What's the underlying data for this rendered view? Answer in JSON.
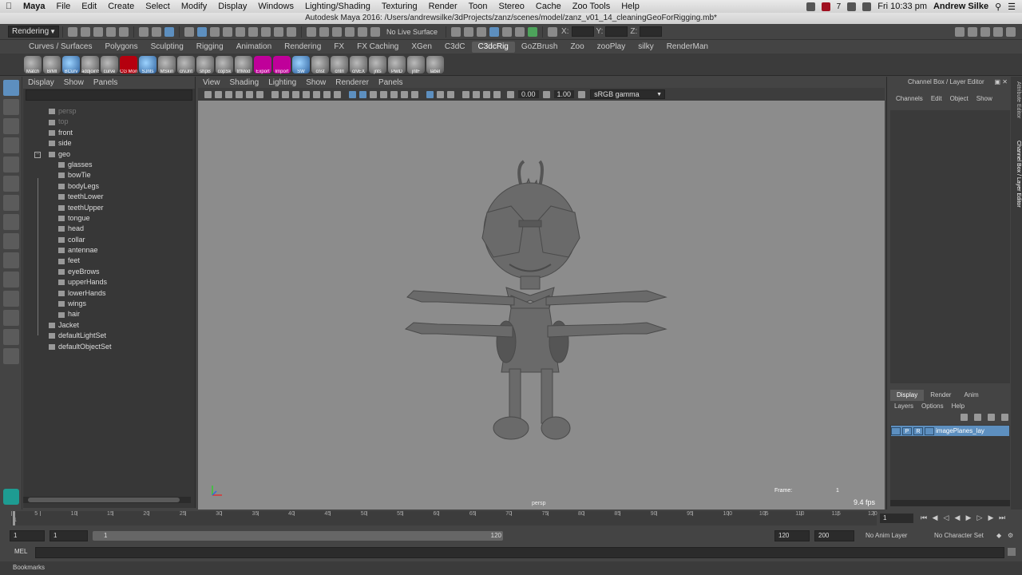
{
  "mac_menubar": {
    "app_name": "Maya",
    "items": [
      "File",
      "Edit",
      "Create",
      "Select",
      "Modify",
      "Display",
      "Windows",
      "Lighting/Shading",
      "Texturing",
      "Render",
      "Toon",
      "Stereo",
      "Cache",
      "Zoo Tools",
      "Help"
    ],
    "right": {
      "badge": "7",
      "clock": "Fri 10:33 pm",
      "user": "Andrew Silke"
    }
  },
  "window": {
    "title": "Autodesk Maya 2016: /Users/andrewsilke/3dProjects/zanz/scenes/model/zanz_v01_14_cleaningGeoForRigging.mb*"
  },
  "status_line": {
    "menu_set": "Rendering",
    "live_surface": "No Live Surface",
    "coord_x": "X:",
    "coord_y": "Y:",
    "coord_z": "Z:"
  },
  "shelf_tabs": [
    "Curves / Surfaces",
    "Polygons",
    "Sculpting",
    "Rigging",
    "Animation",
    "Rendering",
    "FX",
    "FX Caching",
    "XGen",
    "C3dC",
    "C3dcRig",
    "GoZBrush",
    "Zoo",
    "zooPlay",
    "silky",
    "RenderMan"
  ],
  "shelf_active_tab": "C3dcRig",
  "shelf_buttons": [
    {
      "label": "Match",
      "style": ""
    },
    {
      "label": "BrMl",
      "style": ""
    },
    {
      "label": "BCurv",
      "style": "blue"
    },
    {
      "label": "addjoints",
      "style": ""
    },
    {
      "label": "curve",
      "style": ""
    },
    {
      "label": "CG Mon",
      "style": "red"
    },
    {
      "label": "SJnts",
      "style": "blue"
    },
    {
      "label": "MSkin",
      "style": ""
    },
    {
      "label": "crvJnt",
      "style": ""
    },
    {
      "label": "shpB",
      "style": ""
    },
    {
      "label": "copSk",
      "style": ""
    },
    {
      "label": "trfMod",
      "style": ""
    },
    {
      "label": "Export",
      "style": "magenta"
    },
    {
      "label": "Import",
      "style": "magenta"
    },
    {
      "label": "SW",
      "style": "blue"
    },
    {
      "label": "cnst",
      "style": ""
    },
    {
      "label": "cntrl",
      "style": ""
    },
    {
      "label": "crvEX",
      "style": ""
    },
    {
      "label": "jnts",
      "style": ""
    },
    {
      "label": "PwlD",
      "style": ""
    },
    {
      "label": "jntF",
      "style": ""
    },
    {
      "label": "label",
      "style": ""
    }
  ],
  "outliner": {
    "menu": [
      "Display",
      "Show",
      "Panels"
    ],
    "items": [
      {
        "label": "persp",
        "dim": true,
        "depth": 1
      },
      {
        "label": "top",
        "dim": true,
        "depth": 1
      },
      {
        "label": "front",
        "dim": false,
        "depth": 1
      },
      {
        "label": "side",
        "dim": false,
        "depth": 1
      },
      {
        "label": "geo",
        "dim": false,
        "depth": 1,
        "expanded": true
      },
      {
        "label": "glasses",
        "dim": false,
        "depth": 2
      },
      {
        "label": "bowTie",
        "dim": false,
        "depth": 2
      },
      {
        "label": "bodyLegs",
        "dim": false,
        "depth": 2
      },
      {
        "label": "teethLower",
        "dim": false,
        "depth": 2
      },
      {
        "label": "teethUpper",
        "dim": false,
        "depth": 2
      },
      {
        "label": "tongue",
        "dim": false,
        "depth": 2
      },
      {
        "label": "head",
        "dim": false,
        "depth": 2
      },
      {
        "label": "collar",
        "dim": false,
        "depth": 2
      },
      {
        "label": "antennae",
        "dim": false,
        "depth": 2
      },
      {
        "label": "feet",
        "dim": false,
        "depth": 2
      },
      {
        "label": "eyeBrows",
        "dim": false,
        "depth": 2
      },
      {
        "label": "upperHands",
        "dim": false,
        "depth": 2
      },
      {
        "label": "lowerHands",
        "dim": false,
        "depth": 2
      },
      {
        "label": "wings",
        "dim": false,
        "depth": 2
      },
      {
        "label": "hair",
        "dim": false,
        "depth": 2
      },
      {
        "label": "Jacket",
        "dim": false,
        "depth": 1
      },
      {
        "label": "defaultLightSet",
        "dim": false,
        "depth": 1
      },
      {
        "label": "defaultObjectSet",
        "dim": false,
        "depth": 1
      }
    ]
  },
  "viewport": {
    "menu": [
      "View",
      "Shading",
      "Lighting",
      "Show",
      "Renderer",
      "Panels"
    ],
    "exposure": "0.00",
    "gamma": "1.00",
    "color_space": "sRGB gamma",
    "camera": "persp",
    "frame_label": "Frame:",
    "frame_value": "1",
    "fps": "9.4 fps",
    "background_color": "#8c8c8c"
  },
  "channel_box": {
    "title": "Channel Box / Layer Editor",
    "menu": [
      "Channels",
      "Edit",
      "Object",
      "Show"
    ],
    "layer_tabs": [
      "Display",
      "Render",
      "Anim"
    ],
    "layer_menu": [
      "Layers",
      "Options",
      "Help"
    ],
    "layers": [
      {
        "name": "imagePlanes_lay",
        "flags": [
          "",
          "P",
          "R"
        ]
      }
    ]
  },
  "side_tabs": [
    "Attribute Editor",
    "Channel Box / Layer Editor"
  ],
  "time_slider": {
    "ticks": [
      "5",
      "10",
      "15",
      "20",
      "25",
      "30",
      "35",
      "40",
      "45",
      "50",
      "55",
      "60",
      "65",
      "70",
      "75",
      "80",
      "85",
      "90",
      "95",
      "100",
      "105",
      "110",
      "115",
      "120"
    ],
    "tick_start": "1",
    "current_frame": "1"
  },
  "range_slider": {
    "start": "1",
    "playback_start": "1",
    "bar_start": "1",
    "bar_end": "120",
    "playback_end": "120",
    "end": "200",
    "anim_layer": "No Anim Layer",
    "character_set": "No Character Set"
  },
  "command_line": {
    "label": "MEL"
  },
  "help_line": {
    "label": "Bookmarks"
  }
}
